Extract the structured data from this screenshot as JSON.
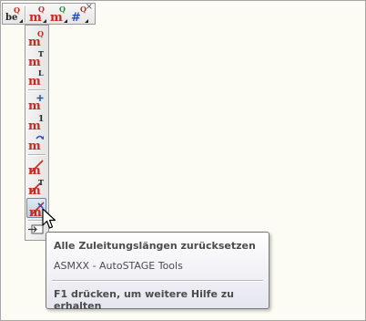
{
  "toolbar": {
    "buttons": [
      {
        "name": "be-q-tool-icon",
        "letters": "be",
        "sup": "Q"
      },
      {
        "name": "mq-tool-icon",
        "letters": "m",
        "sup": "Q"
      },
      {
        "name": "mq-green-tool-icon",
        "letters": "m",
        "sup": "Q"
      },
      {
        "name": "hash-q-tool-icon",
        "letters": "#",
        "sup": "Q"
      }
    ],
    "close_glyph": "×"
  },
  "vertical_toolbar": {
    "buttons": [
      {
        "name": "m-q-icon",
        "sup": "Q"
      },
      {
        "name": "m-t-icon",
        "sup": "T"
      },
      {
        "name": "m-l-icon",
        "sup": "L"
      },
      {
        "name": "m-plus-icon",
        "sup": "+"
      },
      {
        "name": "m-1-icon",
        "sup": "1"
      },
      {
        "name": "m-arrow-icon",
        "sup": "↷"
      },
      {
        "name": "m-strike-icon",
        "sup": ""
      },
      {
        "name": "m-strike-t-icon",
        "sup": "T"
      },
      {
        "name": "m-strike-arrow-icon",
        "sup": ""
      },
      {
        "name": "dock-icon",
        "sup": ""
      }
    ]
  },
  "tooltip": {
    "title": "Alle Zuleitungslängen zurücksetzen",
    "subtitle": "ASMXX - AutoSTAGE Tools",
    "help": "F1 drücken, um weitere Hilfe zu erhalten"
  },
  "colors": {
    "icon_red": "#c42a1e",
    "icon_dark": "#222222",
    "icon_blue": "#2a4fb8",
    "icon_green": "#2e8b3a",
    "background": "#fcfcf4"
  }
}
